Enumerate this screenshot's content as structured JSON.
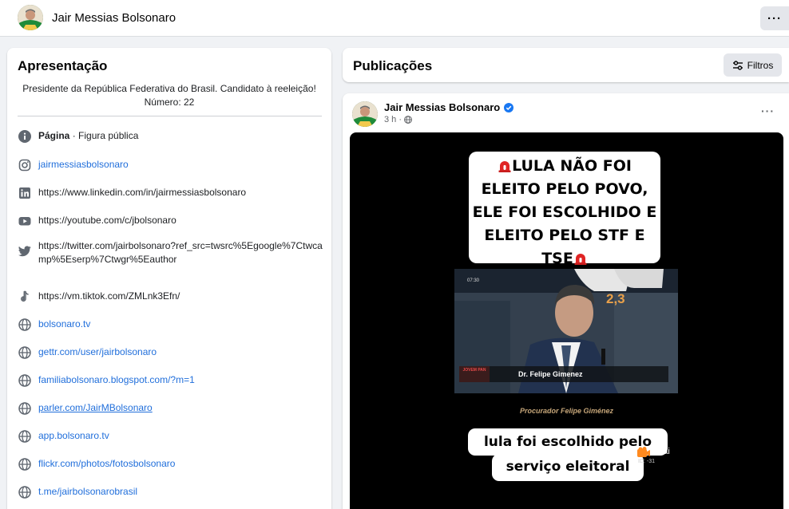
{
  "header": {
    "page_name": "Jair Messias Bolsonaro",
    "more_label": "···"
  },
  "intro": {
    "title": "Apresentação",
    "bio": "Presidente da República Federativa do Brasil. Candidato à reeleição! Número: 22",
    "category_label": "Página",
    "category_value": " · Figura pública",
    "links": [
      {
        "icon": "instagram-icon",
        "text": "jairmessiasbolsonaro",
        "style": "link"
      },
      {
        "icon": "linkedin-icon",
        "text": "https://www.linkedin.com/in/jairmessiasbolsonaro",
        "style": "plain"
      },
      {
        "icon": "youtube-icon",
        "text": "https://youtube.com/c/jbolsonaro",
        "style": "plain"
      },
      {
        "icon": "twitter-icon",
        "text": "https://twitter.com/jairbolsonaro?ref_src=twsrc%5Egoogle%7Ctwcamp%5Eserp%7Ctwgr%5Eauthor",
        "style": "plain"
      },
      {
        "icon": "tiktok-icon",
        "text": "https://vm.tiktok.com/ZMLnk3Efn/",
        "style": "plain"
      },
      {
        "icon": "globe-icon",
        "text": "bolsonaro.tv",
        "style": "link"
      },
      {
        "icon": "globe-icon",
        "text": "gettr.com/user/jairbolsonaro",
        "style": "link"
      },
      {
        "icon": "globe-icon",
        "text": "familiabolsonaro.blogspot.com/?m=1",
        "style": "link"
      },
      {
        "icon": "globe-icon",
        "text": "parler.com/JairMBolsonaro",
        "style": "link"
      },
      {
        "icon": "globe-icon",
        "text": "app.bolsonaro.tv",
        "style": "link"
      },
      {
        "icon": "globe-icon",
        "text": "flickr.com/photos/fotosbolsonaro",
        "style": "link"
      },
      {
        "icon": "globe-icon",
        "text": "t.me/jairbolsonarobrasil",
        "style": "link"
      }
    ]
  },
  "publications": {
    "title": "Publicações",
    "filter_label": "Filtros"
  },
  "post": {
    "author": "Jair Messias Bolsonaro",
    "time": "3 h ·",
    "more_label": "···",
    "media": {
      "headline_lines": [
        "LULA NÃO FOI",
        "ELEITO PELO POVO,",
        "ELE FOI ESCOLHIDO E",
        "ELEITO PELO STF E",
        "TSE"
      ],
      "video_time": "07:30",
      "video_number": "2,3",
      "video_logo": "JOVEM PAN",
      "lower_third": "Dr. Felipe Gimenez",
      "caption": "Procurador Felipe Giménez",
      "bottom_line1": "lula foi escolhido pelo",
      "bottom_line2": "serviço eleitoral",
      "watermark": "Kwai",
      "watermark_id": "ID: -31"
    }
  },
  "colors": {
    "link": "#216fdb",
    "background": "#f0f2f5",
    "siren": "#e02424"
  }
}
